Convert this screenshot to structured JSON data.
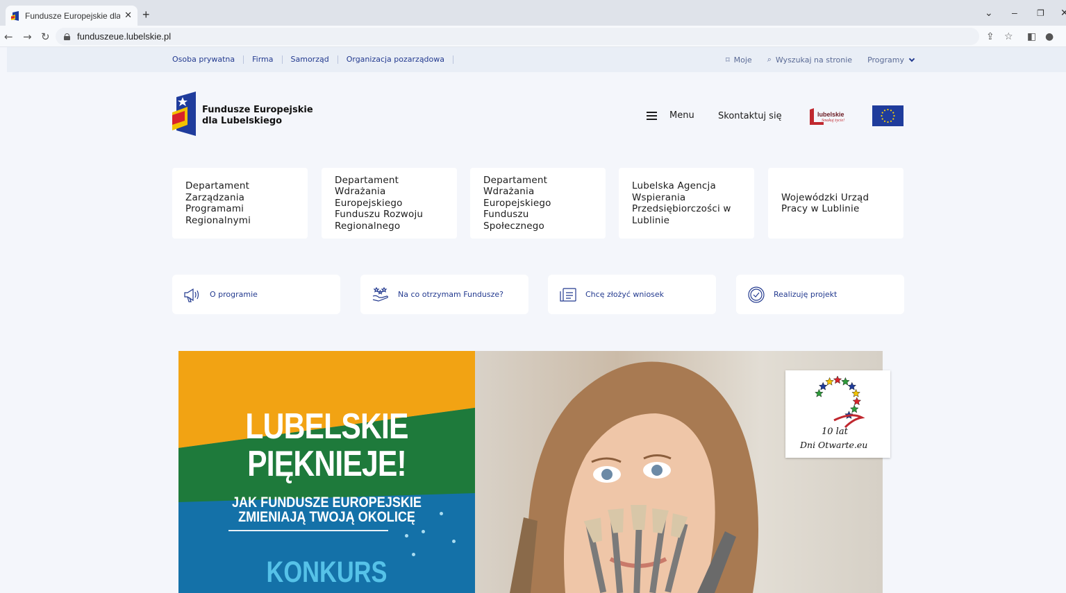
{
  "browser": {
    "tab_title": "Fundusze Europejskie dla Lubelskiego",
    "new_tab": "+",
    "url": "funduszeue.lubelskie.pl"
  },
  "utility_bar": {
    "left_links": [
      "Osoba prywatna",
      "Firma",
      "Samorząd",
      "Organizacja pozarządowa"
    ],
    "moje": "Moje",
    "search": "Wyszukaj na stronie",
    "programy": "Programy"
  },
  "header": {
    "brand_line1": "Fundusze Europejskie",
    "brand_line2": "dla Lubelskiego",
    "menu_label": "Menu",
    "contact_label": "Skontaktuj się",
    "lubelskie_text": "lubelskie",
    "lubelskie_tagline": "Smakuj życie!"
  },
  "departments": [
    {
      "label": "Departament Zarządzania Programami Regionalnymi"
    },
    {
      "label": "Departament Wdrażania Europejskiego Funduszu Rozwoju Regionalnego"
    },
    {
      "label": "Departament Wdrażania Europejskiego Funduszu Społecznego"
    },
    {
      "label": "Lubelska Agencja Wspierania Przedsiębiorczości w Lublinie"
    },
    {
      "label": "Wojewódzki Urząd Pracy w Lublinie"
    }
  ],
  "quick_links": [
    {
      "label": "O programie",
      "icon": "megaphone-icon"
    },
    {
      "label": "Na co otrzymam Fundusze?",
      "icon": "hands-stars-icon"
    },
    {
      "label": "Chcę złożyć wniosek",
      "icon": "document-icon"
    },
    {
      "label": "Realizuję projekt",
      "icon": "check-circle-icon"
    }
  ],
  "banner": {
    "title_line1": "LUBELSKIE",
    "title_line2": "PIĘKNIEJE!",
    "subtitle_line1": "JAK FUNDUSZE EUROPEJSKIE",
    "subtitle_line2": "ZMIENIAJĄ TWOJĄ OKOLICĘ",
    "contest": "KONKURS PLASTYCZNY",
    "badge_line1": "10 lat",
    "badge_line2": "Dni Otwarte.eu"
  },
  "colors": {
    "brand_blue": "#233a8f",
    "banner_yellow": "#f2a313",
    "banner_green": "#1e7a3b",
    "banner_blue": "#1471a8"
  }
}
